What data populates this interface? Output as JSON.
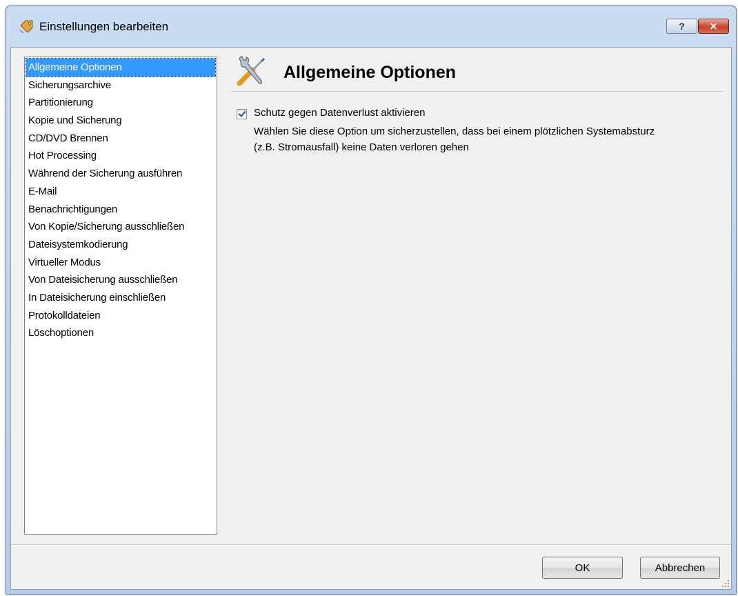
{
  "window": {
    "title": "Einstellungen bearbeiten",
    "help_button": "?",
    "close_button": "✕"
  },
  "sidebar": {
    "items": [
      {
        "label": "Allgemeine Optionen",
        "selected": true
      },
      {
        "label": "Sicherungsarchive"
      },
      {
        "label": "Partitionierung"
      },
      {
        "label": "Kopie und Sicherung"
      },
      {
        "label": "CD/DVD Brennen"
      },
      {
        "label": "Hot Processing"
      },
      {
        "label": "Während der Sicherung ausführen"
      },
      {
        "label": "E-Mail"
      },
      {
        "label": "Benachrichtigungen"
      },
      {
        "label": "Von Kopie/Sicherung ausschließen"
      },
      {
        "label": "Dateisystemkodierung"
      },
      {
        "label": "Virtueller Modus"
      },
      {
        "label": "Von Dateisicherung ausschließen"
      },
      {
        "label": "In Dateisicherung einschließen"
      },
      {
        "label": "Protokolldateien"
      },
      {
        "label": "Löschoptionen"
      }
    ]
  },
  "content": {
    "icon": "tools-icon",
    "title": "Allgemeine Optionen",
    "option": {
      "checked": true,
      "label": "Schutz gegen Datenverlust aktivieren",
      "description_line1": "Wählen Sie diese Option um sicherzustellen, dass bei einem plötzlichen Systemabsturz",
      "description_line2": "(z.B. Stromausfall) keine Daten verloren gehen"
    }
  },
  "footer": {
    "ok_label": "OK",
    "cancel_label": "Abbrechen"
  },
  "colors": {
    "selection": "#3399ff",
    "frame": "#b5cce8",
    "close_button": "#c5432c"
  }
}
